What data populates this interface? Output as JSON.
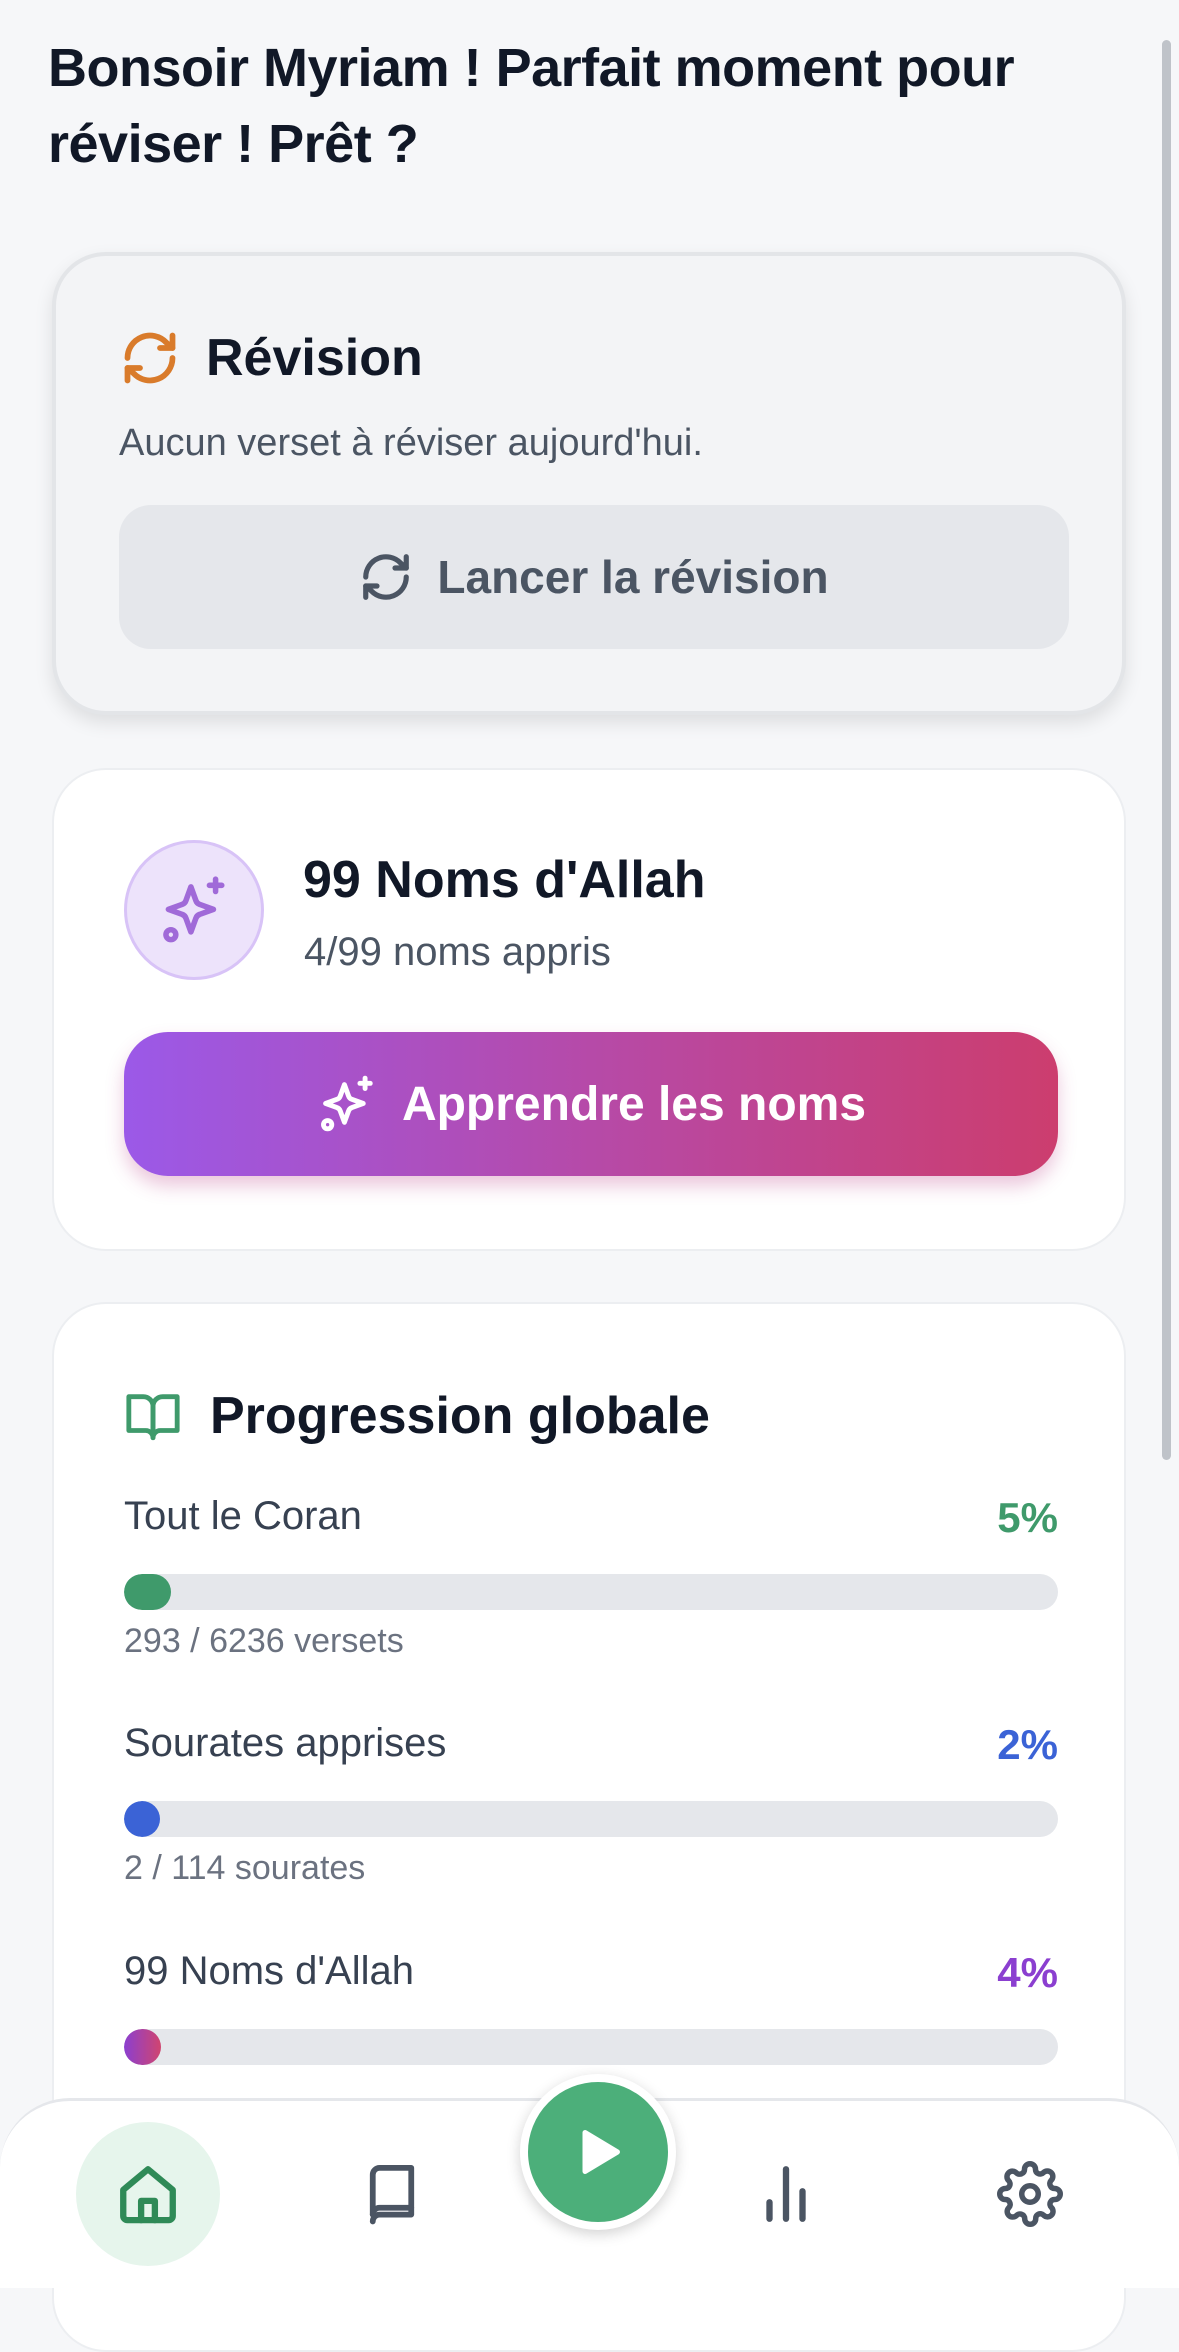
{
  "greeting": "Bonsoir Myriam ! Parfait moment pour réviser ! Prêt ?",
  "revision": {
    "title": "Révision",
    "subtitle": "Aucun verset à réviser aujourd'hui.",
    "button_label": "Lancer la révision",
    "icon": "refresh-icon",
    "accent": "#d97b2b"
  },
  "names": {
    "title": "99 Noms d'Allah",
    "subtitle": "4/99 noms appris",
    "button_label": "Apprendre les noms",
    "icon": "sparkles-icon"
  },
  "progress": {
    "title": "Progression globale",
    "icon": "book-open-icon",
    "items": [
      {
        "label": "Tout le Coran",
        "percent_text": "5%",
        "value": 5,
        "detail": "293 / 6236 versets",
        "color": "#3f9a6b"
      },
      {
        "label": "Sourates apprises",
        "percent_text": "2%",
        "value": 2,
        "detail": "2 / 114 sourates",
        "color": "#3b63d6"
      },
      {
        "label": "99 Noms d'Allah",
        "percent_text": "4%",
        "value": 4,
        "detail": "",
        "color": "#8b3fd0"
      }
    ]
  },
  "nav": {
    "items": [
      "home-icon",
      "book-icon",
      "play-icon",
      "bar-chart-icon",
      "settings-icon"
    ],
    "active": "home-icon",
    "accent": "#2f8a57"
  }
}
